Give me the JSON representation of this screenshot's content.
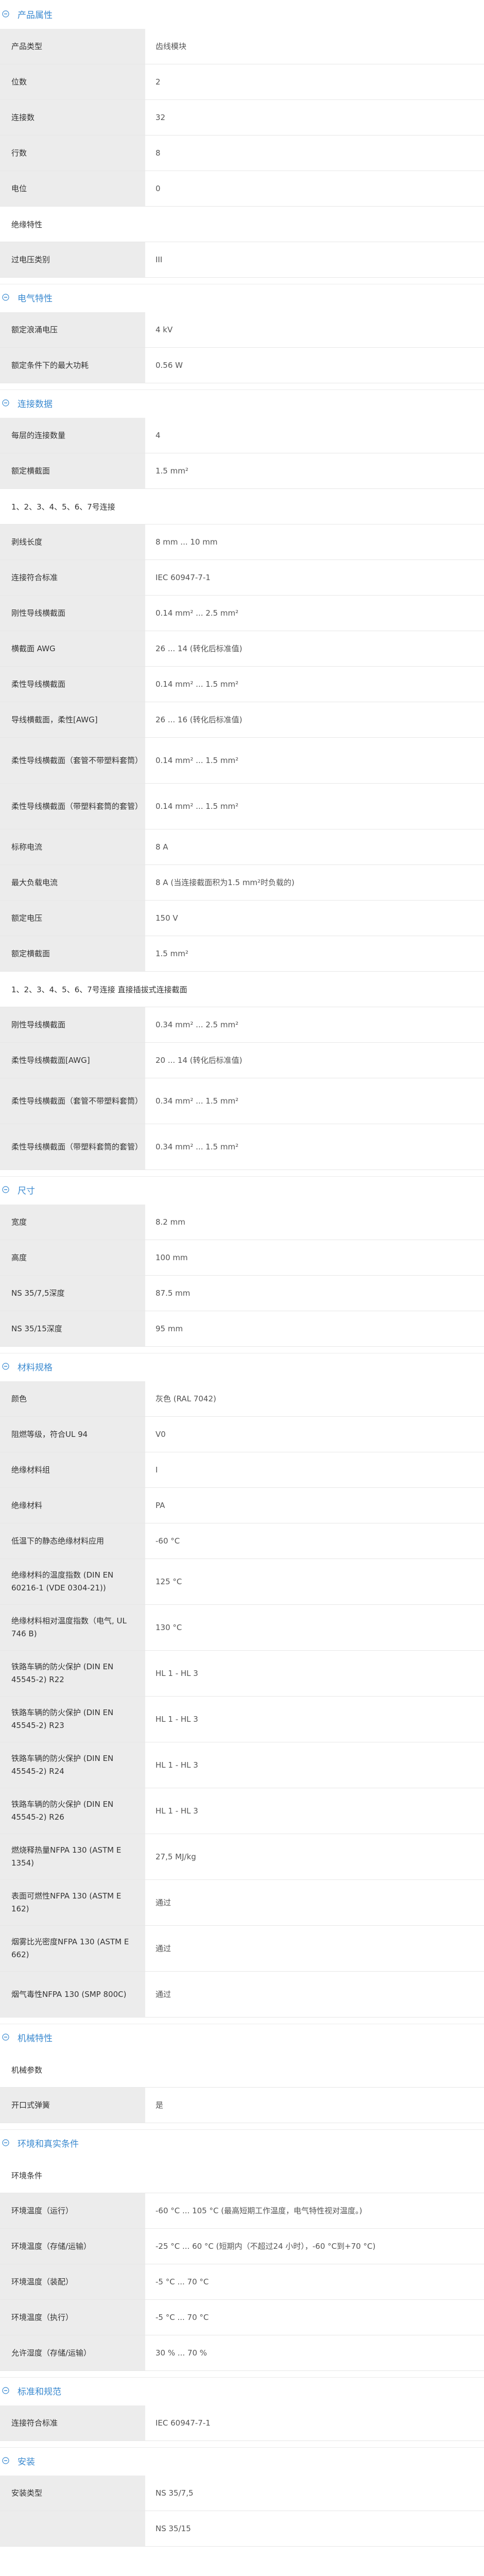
{
  "sections": {
    "product": {
      "title": "产品属性",
      "rows": [
        {
          "k": "产品类型",
          "v": "齿线模块"
        },
        {
          "k": "位数",
          "v": "2"
        },
        {
          "k": "连接数",
          "v": "32"
        },
        {
          "k": "行数",
          "v": "8"
        },
        {
          "k": "电位",
          "v": "0"
        }
      ],
      "sub": "绝缘特性",
      "rows2": [
        {
          "k": "过电压类别",
          "v": "III"
        }
      ]
    },
    "electrical": {
      "title": "电气特性",
      "rows": [
        {
          "k": "额定浪涌电压",
          "v": "4 kV"
        },
        {
          "k": "额定条件下的最大功耗",
          "v": "0.56 W"
        }
      ]
    },
    "connection": {
      "title": "连接数据",
      "rows": [
        {
          "k": "每层的连接数量",
          "v": "4"
        },
        {
          "k": "额定横截面",
          "v": "1.5 mm²"
        }
      ],
      "sub1": "1、2、3、4、5、6、7号连接",
      "rows1": [
        {
          "k": "剥线长度",
          "v": "8 mm ... 10 mm"
        },
        {
          "k": "连接符合标准",
          "v": "IEC 60947-7-1"
        },
        {
          "k": "刚性导线横截面",
          "v": "0.14 mm² ... 2.5 mm²"
        },
        {
          "k": "横截面 AWG",
          "v": "26 ... 14 (转化后标准值)"
        },
        {
          "k": "柔性导线横截面",
          "v": "0.14 mm² ... 1.5 mm²"
        },
        {
          "k": "导线横截面，柔性[AWG]",
          "v": "26 ... 16 (转化后标准值)"
        },
        {
          "k": "柔性导线横截面（套管不带塑料套筒）",
          "v": "0.14 mm² ... 1.5 mm²"
        },
        {
          "k": "柔性导线横截面（带塑料套筒的套管）",
          "v": "0.14 mm² ... 1.5 mm²"
        },
        {
          "k": "标称电流",
          "v": "8 A"
        },
        {
          "k": "最大负载电流",
          "v": "8 A (当连接截面积为1.5 mm²时负载的)"
        },
        {
          "k": "额定电压",
          "v": "150 V"
        },
        {
          "k": "额定横截面",
          "v": "1.5 mm²"
        }
      ],
      "sub2": "1、2、3、4、5、6、7号连接 直接插拔式连接截面",
      "rows2": [
        {
          "k": "刚性导线横截面",
          "v": "0.34 mm² ... 2.5 mm²"
        },
        {
          "k": "柔性导线横截面[AWG]",
          "v": "20 ... 14 (转化后标准值)"
        },
        {
          "k": "柔性导线横截面（套管不带塑料套筒）",
          "v": "0.34 mm² ... 1.5 mm²"
        },
        {
          "k": "柔性导线横截面（带塑料套筒的套管）",
          "v": "0.34 mm² ... 1.5 mm²"
        }
      ]
    },
    "dimensions": {
      "title": "尺寸",
      "rows": [
        {
          "k": "宽度",
          "v": "8.2 mm"
        },
        {
          "k": "高度",
          "v": "100 mm"
        },
        {
          "k": "NS 35/7,5深度",
          "v": "87.5 mm"
        },
        {
          "k": "NS 35/15深度",
          "v": "95 mm"
        }
      ]
    },
    "material": {
      "title": "材料规格",
      "rows": [
        {
          "k": "颜色",
          "v": "灰色 (RAL 7042)"
        },
        {
          "k": "阻燃等级，符合UL 94",
          "v": "V0"
        },
        {
          "k": "绝缘材料组",
          "v": "I"
        },
        {
          "k": "绝缘材料",
          "v": "PA"
        },
        {
          "k": "低温下的静态绝缘材料应用",
          "v": "-60 °C"
        },
        {
          "k": "绝缘材料的温度指数 (DIN EN 60216-1 (VDE 0304-21))",
          "v": "125 °C"
        },
        {
          "k": "绝缘材料相对温度指数（电气, UL 746 B)",
          "v": "130 °C"
        },
        {
          "k": "铁路车辆的防火保护 (DIN EN 45545-2) R22",
          "v": "HL 1 - HL 3"
        },
        {
          "k": "铁路车辆的防火保护 (DIN EN 45545-2) R23",
          "v": "HL 1 - HL 3"
        },
        {
          "k": "铁路车辆的防火保护 (DIN EN 45545-2) R24",
          "v": "HL 1 - HL 3"
        },
        {
          "k": "铁路车辆的防火保护 (DIN EN 45545-2) R26",
          "v": "HL 1 - HL 3"
        },
        {
          "k": "燃烧释热量NFPA 130 (ASTM E 1354)",
          "v": "27,5 MJ/kg"
        },
        {
          "k": "表面可燃性NFPA 130 (ASTM E 162)",
          "v": "通过"
        },
        {
          "k": "烟雾比光密度NFPA 130 (ASTM E 662)",
          "v": "通过"
        },
        {
          "k": "烟气毒性NFPA 130 (SMP 800C)",
          "v": "通过"
        }
      ]
    },
    "mechanical": {
      "title": "机械特性",
      "sub": "机械参数",
      "rows": [
        {
          "k": "开口式弹簧",
          "v": "是"
        }
      ]
    },
    "environment": {
      "title": "环境和真实条件",
      "sub": "环境条件",
      "rows": [
        {
          "k": "环境温度（运行）",
          "v": "-60 °C ... 105 °C (最高短期工作温度，电气特性视对温度。)"
        },
        {
          "k": "环境温度（存储/运输）",
          "v": "-25 °C ... 60 °C (短期内（不超过24 小时），-60 °C到+70 °C)"
        },
        {
          "k": "环境温度（装配）",
          "v": "-5 °C ... 70 °C"
        },
        {
          "k": "环境温度（执行）",
          "v": "-5 °C ... 70 °C"
        },
        {
          "k": "允许湿度（存储/运输）",
          "v": "30 % ... 70 %"
        }
      ]
    },
    "standards": {
      "title": "标准和规范",
      "rows": [
        {
          "k": "连接符合标准",
          "v": "IEC 60947-7-1"
        }
      ]
    },
    "mounting": {
      "title": "安装",
      "rows": [
        {
          "k": "安装类型",
          "v": "NS 35/7,5"
        },
        {
          "k": "",
          "v": "NS 35/15"
        }
      ]
    }
  },
  "colors": {
    "accent": "#3b8ad0",
    "label_bg": "#ececec"
  },
  "icon": "minus-circle-icon"
}
